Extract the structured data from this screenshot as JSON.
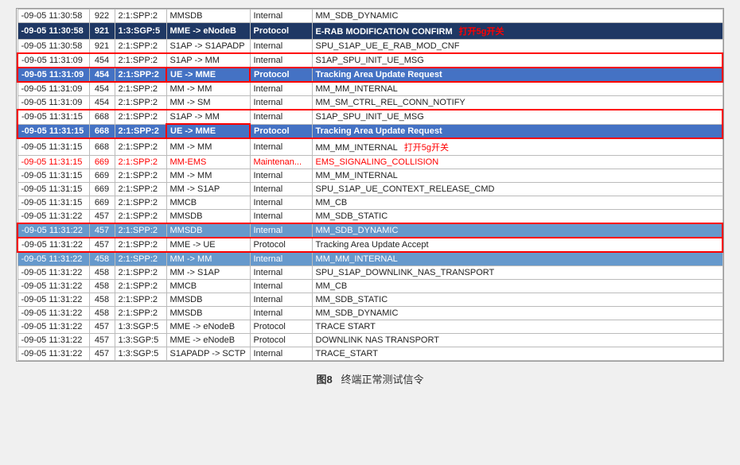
{
  "caption": {
    "figure_num": "图8",
    "figure_label": "终端正常测试信令"
  },
  "rows": [
    {
      "time": "-09-05 11:30:58",
      "id": "922",
      "node": "2:1:SPP:2",
      "direction": "MMSDB",
      "type": "Internal",
      "message": "MM_SDB_DYNAMIC",
      "style": "normal"
    },
    {
      "time": "-09-05 11:30:58",
      "id": "921",
      "node": "1:3:SGP:5",
      "direction": "MME -> eNodeB",
      "type": "Protocol",
      "message": "E-RAB MODIFICATION CONFIRM",
      "style": "dark-blue",
      "annotation": "打开5g开关",
      "annotation_side": "right"
    },
    {
      "time": "-09-05 11:30:58",
      "id": "921",
      "node": "2:1:SPP:2",
      "direction": "S1AP -> S1APADP",
      "type": "Internal",
      "message": "SPU_S1AP_UE_E_RAB_MOD_CNF",
      "style": "normal"
    },
    {
      "time": "-09-05 11:31:09",
      "id": "454",
      "node": "2:1:SPP:2",
      "direction": "S1AP -> MM",
      "type": "Internal",
      "message": "S1AP_SPU_INIT_UE_MSG",
      "style": "normal",
      "red_border": true
    },
    {
      "time": "-09-05 11:31:09",
      "id": "454",
      "node": "2:1:SPP:2",
      "direction": "UE -> MME",
      "type": "Protocol",
      "message": "Tracking Area Update Request",
      "style": "highlighted",
      "red_border_direction": true
    },
    {
      "time": "-09-05 11:31:09",
      "id": "454",
      "node": "2:1:SPP:2",
      "direction": "MM -> MM",
      "type": "Internal",
      "message": "MM_MM_INTERNAL",
      "style": "normal"
    },
    {
      "time": "-09-05 11:31:09",
      "id": "454",
      "node": "2:1:SPP:2",
      "direction": "MM -> SM",
      "type": "Internal",
      "message": "MM_SM_CTRL_REL_CONN_NOTIFY",
      "style": "normal"
    },
    {
      "time": "-09-05 11:31:15",
      "id": "668",
      "node": "2:1:SPP:2",
      "direction": "S1AP -> MM",
      "type": "Internal",
      "message": "S1AP_SPU_INIT_UE_MSG",
      "style": "normal"
    },
    {
      "time": "-09-05 11:31:15",
      "id": "668",
      "node": "2:1:SPP:2",
      "direction": "UE -> MME",
      "type": "Protocol",
      "message": "Tracking Area Update Request",
      "style": "highlighted",
      "red_border_direction": true
    },
    {
      "time": "-09-05 11:31:15",
      "id": "668",
      "node": "2:1:SPP:2",
      "direction": "MM -> MM",
      "type": "Internal",
      "message": "MM_MM_INTERNAL",
      "style": "normal",
      "annotation": "打开5g开关",
      "annotation_side": "right"
    },
    {
      "time": "-09-05 11:31:15",
      "id": "669",
      "node": "2:1:SPP:2",
      "direction": "MM-EMS",
      "type": "Maintenan...",
      "message": "EMS_SIGNALING_COLLISION",
      "style": "red-text"
    },
    {
      "time": "-09-05 11:31:15",
      "id": "669",
      "node": "2:1:SPP:2",
      "direction": "MM -> MM",
      "type": "Internal",
      "message": "MM_MM_INTERNAL",
      "style": "normal"
    },
    {
      "time": "-09-05 11:31:15",
      "id": "669",
      "node": "2:1:SPP:2",
      "direction": "MM -> S1AP",
      "type": "Internal",
      "message": "SPU_S1AP_UE_CONTEXT_RELEASE_CMD",
      "style": "normal"
    },
    {
      "time": "-09-05 11:31:15",
      "id": "669",
      "node": "2:1:SPP:2",
      "direction": "MMCB",
      "type": "Internal",
      "message": "MM_CB",
      "style": "normal"
    },
    {
      "time": "-09-05 11:31:22",
      "id": "457",
      "node": "2:1:SPP:2",
      "direction": "MMSDB",
      "type": "Internal",
      "message": "MM_SDB_STATIC",
      "style": "normal",
      "partial_cut": true
    },
    {
      "time": "-09-05 11:31:22",
      "id": "457",
      "node": "2:1:SPP:2",
      "direction": "MMSDB",
      "type": "Internal",
      "message": "MM_SDB_DYNAMIC",
      "style": "subhighlight",
      "red_border": true
    },
    {
      "time": "-09-05 11:31:22",
      "id": "457",
      "node": "2:1:SPP:2",
      "direction": "MME -> UE",
      "type": "Protocol",
      "message": "Tracking Area Update Accept",
      "style": "normal",
      "red_border": true
    },
    {
      "time": "-09-05 11:31:22",
      "id": "458",
      "node": "2:1:SPP:2",
      "direction": "MM -> MM",
      "type": "Internal",
      "message": "MM_MM_INTERNAL",
      "style": "subhighlight"
    },
    {
      "time": "-09-05 11:31:22",
      "id": "458",
      "node": "2:1:SPP:2",
      "direction": "MM -> S1AP",
      "type": "Internal",
      "message": "SPU_S1AP_DOWNLINK_NAS_TRANSPORT",
      "style": "normal"
    },
    {
      "time": "-09-05 11:31:22",
      "id": "458",
      "node": "2:1:SPP:2",
      "direction": "MMCB",
      "type": "Internal",
      "message": "MM_CB",
      "style": "normal"
    },
    {
      "time": "-09-05 11:31:22",
      "id": "458",
      "node": "2:1:SPP:2",
      "direction": "MMSDB",
      "type": "Internal",
      "message": "MM_SDB_STATIC",
      "style": "normal"
    },
    {
      "time": "-09-05 11:31:22",
      "id": "458",
      "node": "2:1:SPP:2",
      "direction": "MMSDB",
      "type": "Internal",
      "message": "MM_SDB_DYNAMIC",
      "style": "normal"
    },
    {
      "time": "-09-05 11:31:22",
      "id": "457",
      "node": "1:3:SGP:5",
      "direction": "MME -> eNodeB",
      "type": "Protocol",
      "message": "TRACE START",
      "style": "normal"
    },
    {
      "time": "-09-05 11:31:22",
      "id": "457",
      "node": "1:3:SGP:5",
      "direction": "MME -> eNodeB",
      "type": "Protocol",
      "message": "DOWNLINK NAS TRANSPORT",
      "style": "normal"
    },
    {
      "time": "-09-05 11:31:22",
      "id": "457",
      "node": "1:3:SGP:5",
      "direction": "S1APADP -> SCTP",
      "type": "Internal",
      "message": "TRACE_START",
      "style": "normal"
    }
  ]
}
